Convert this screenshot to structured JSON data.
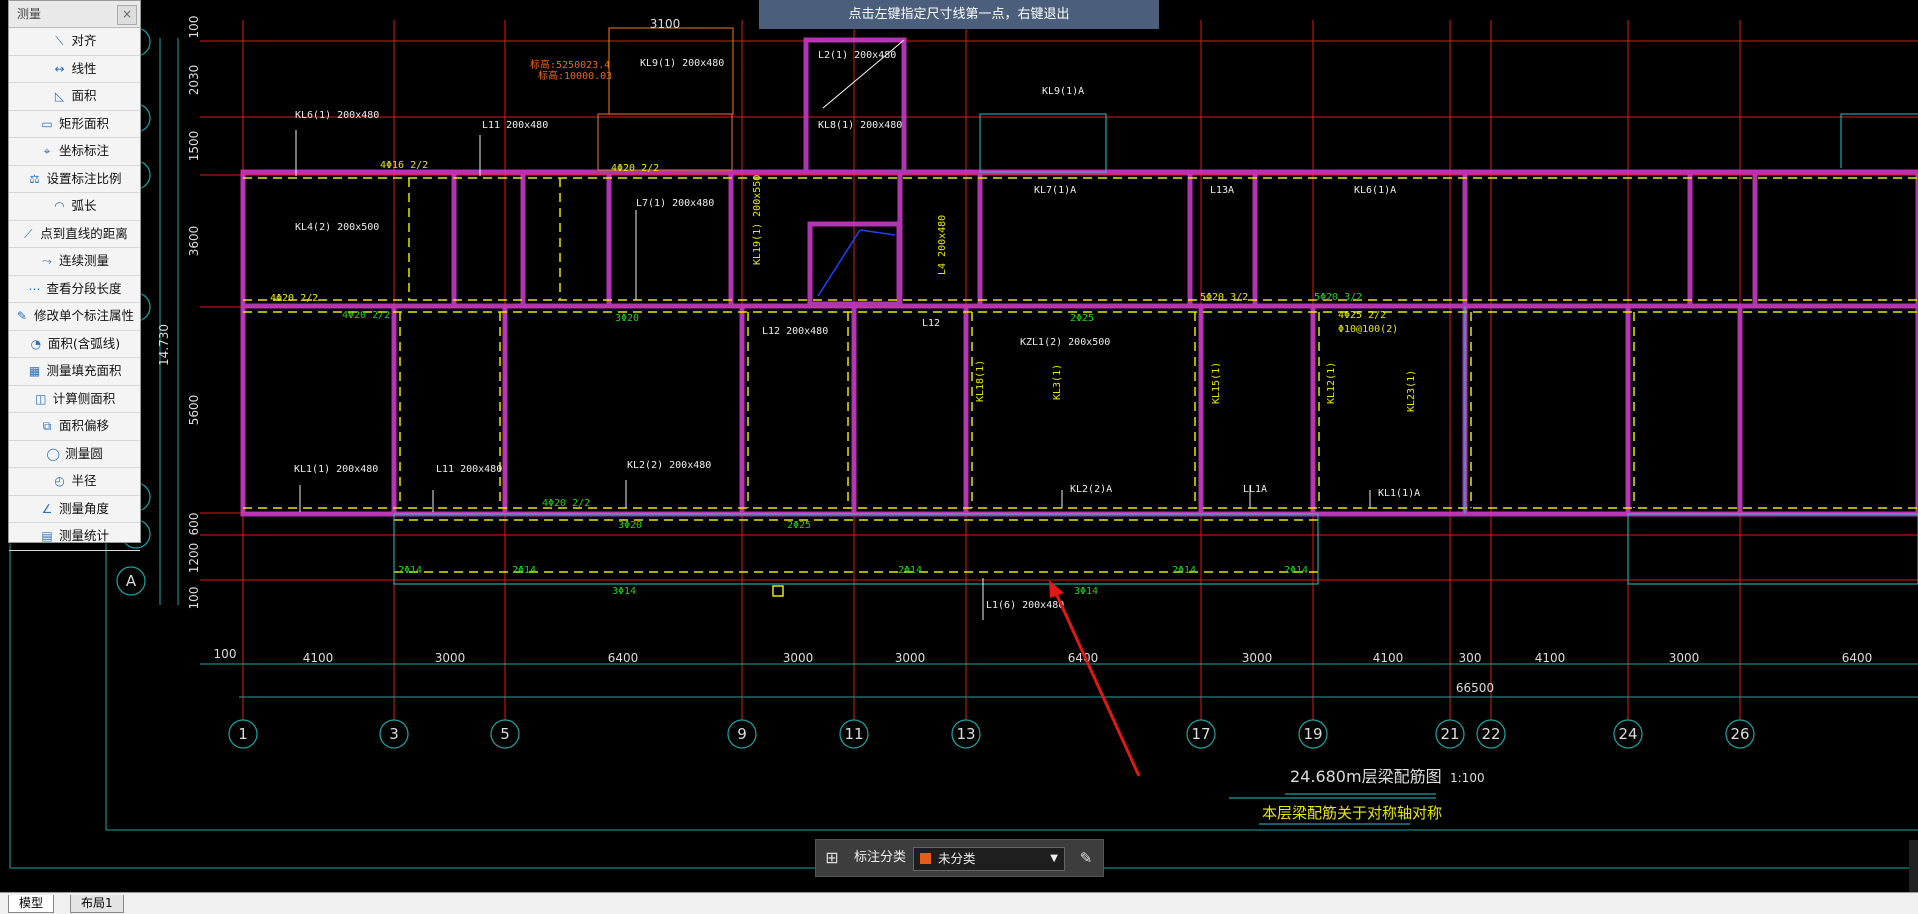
{
  "measure_panel": {
    "title": "测量",
    "close": "×",
    "tools": [
      {
        "label": "对齐",
        "icon": "align-icon",
        "glyph": "⟍"
      },
      {
        "label": "线性",
        "icon": "linear-icon",
        "glyph": "↔"
      },
      {
        "label": "面积",
        "icon": "area-icon",
        "glyph": "◺"
      },
      {
        "label": "矩形面积",
        "icon": "rect-area-icon",
        "glyph": "▭"
      },
      {
        "label": "坐标标注",
        "icon": "coordinate-icon",
        "glyph": "⌖"
      },
      {
        "label": "设置标注比例",
        "icon": "scale-icon",
        "glyph": "⚖"
      },
      {
        "label": "弧长",
        "icon": "arc-icon",
        "glyph": "◠"
      },
      {
        "label": "点到直线的距离",
        "icon": "point-line-icon",
        "glyph": "⟋"
      },
      {
        "label": "连续测量",
        "icon": "continuous-icon",
        "glyph": "⤳"
      },
      {
        "label": "查看分段长度",
        "icon": "segment-icon",
        "glyph": "⋯"
      },
      {
        "label": "修改单个标注属性",
        "icon": "edit-dim-icon",
        "glyph": "✎"
      },
      {
        "label": "面积(含弧线)",
        "icon": "arc-area-icon",
        "glyph": "◔"
      },
      {
        "label": "测量填充面积",
        "icon": "fill-area-icon",
        "glyph": "▦"
      },
      {
        "label": "计算侧面积",
        "icon": "side-area-icon",
        "glyph": "◫"
      },
      {
        "label": "面积偏移",
        "icon": "offset-icon",
        "glyph": "⧉"
      },
      {
        "label": "测量圆",
        "icon": "circle-icon",
        "glyph": "◯"
      },
      {
        "label": "半径",
        "icon": "radius-icon",
        "glyph": "◴"
      },
      {
        "label": "测量角度",
        "icon": "angle-icon",
        "glyph": "∠"
      },
      {
        "label": "测量统计",
        "icon": "stats-icon",
        "glyph": "▤"
      }
    ]
  },
  "hint": "点击左键指定尺寸线第一点，右键退出",
  "annotation_bar": {
    "label": "标注分类",
    "value": "未分类",
    "swatch": "#e85c1a"
  },
  "layout_tabs": [
    "模型",
    "布局1"
  ],
  "drawing": {
    "title": "24.680m层梁配筋图",
    "scale": "1:100",
    "note": "本层梁配筋关于对称轴对称",
    "total_dim": "66500",
    "axis_labels": [
      "1",
      "3",
      "5",
      "9",
      "11",
      "13",
      "17",
      "19",
      "21",
      "22",
      "24",
      "26"
    ],
    "bottom_dims": [
      "4100",
      "3000",
      "6400",
      "3000",
      "3000",
      "6400",
      "3000",
      "4100",
      "300",
      "4100",
      "3000",
      "6400"
    ],
    "left_dims": [
      "100",
      "2030",
      "1500",
      "3600",
      "5600",
      "600",
      "1200",
      "100"
    ],
    "left_total": "14.730",
    "left_offset": "100",
    "row_label": "A",
    "beam_labels": [
      {
        "t": "KL6(1)  200x480"
      },
      {
        "t": "KL9(1)  200x480"
      },
      {
        "t": "L2(1)  200x480"
      },
      {
        "t": "KL8(1)  200x480"
      },
      {
        "t": "L11  200x480"
      },
      {
        "t": "KL9(1)A"
      },
      {
        "t": "KL7(1)A"
      },
      {
        "t": "L13A"
      },
      {
        "t": "KL6(1)A"
      },
      {
        "t": "KL4(2)  200x500"
      },
      {
        "t": "L7(1)  200x480"
      },
      {
        "t": "KZL1(2)  200x500"
      },
      {
        "t": "KL1(1)  200x480"
      },
      {
        "t": "L11  200x480"
      },
      {
        "t": "KL2(2)  200x480"
      },
      {
        "t": "KL2(2)A"
      },
      {
        "t": "LL1A"
      },
      {
        "t": "KL1(1)A"
      },
      {
        "t": "L1(6)  200x480"
      },
      {
        "t": "L12  200x480"
      },
      {
        "t": "L12"
      },
      {
        "t": "KL19(1)  200x550"
      },
      {
        "t": "L4  200x480"
      },
      {
        "t": "KL3(1)"
      },
      {
        "t": "KL18(1)"
      },
      {
        "t": "KL15(1)"
      },
      {
        "t": "KL12(1)"
      },
      {
        "t": "KL23(1)"
      },
      {
        "t": "4Φ25  2/2"
      },
      {
        "t": "Φ10@100(2)"
      },
      {
        "t": "4Φ20  2/2"
      },
      {
        "t": "5Φ20  3/2"
      },
      {
        "t": "3Φ20"
      },
      {
        "t": "2Φ25"
      },
      {
        "t": "3Φ14"
      },
      {
        "t": "2Φ14"
      },
      {
        "t": "4Φ16  2/2"
      }
    ],
    "top_dim": "3100",
    "red_note_1": "标高:5250023.4",
    "red_note_2": "标高:10000.03"
  }
}
